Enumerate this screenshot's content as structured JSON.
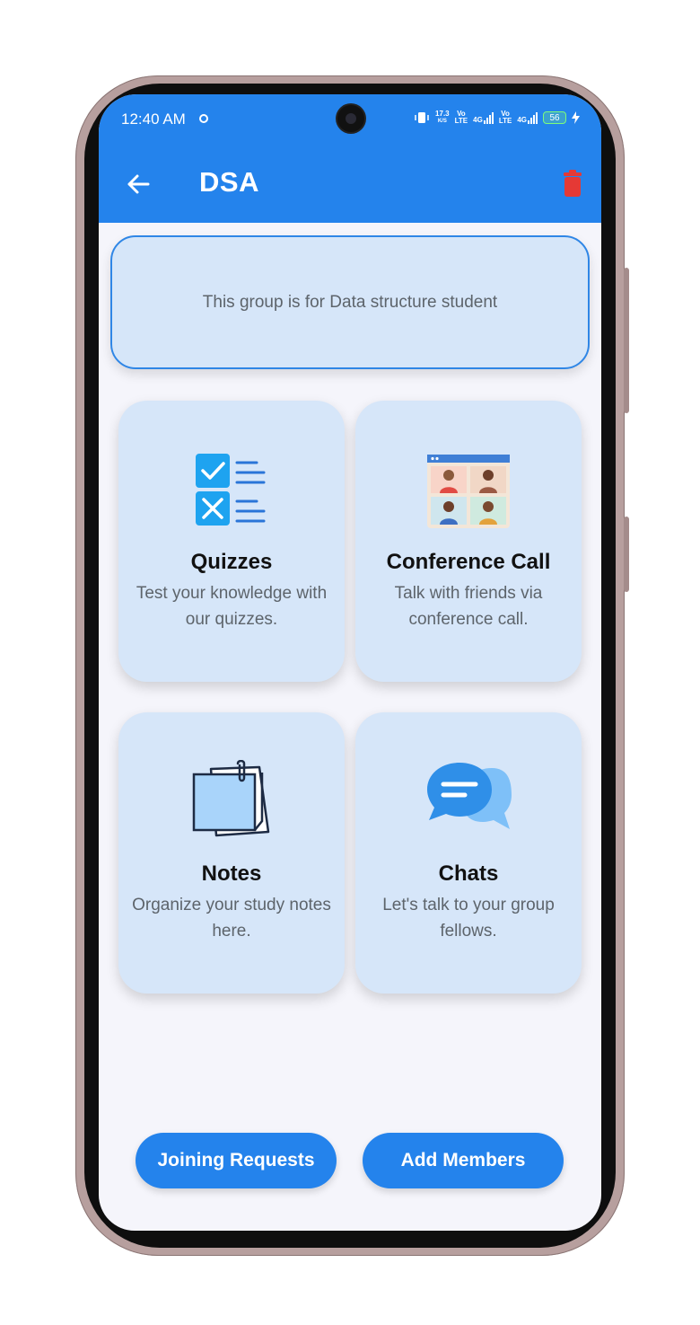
{
  "status_bar": {
    "time": "12:40 AM",
    "net_speed_value": "17.3",
    "net_speed_unit": "K/S",
    "volte_1_top": "Vo",
    "volte_1_bottom": "LTE",
    "net_type_1": "4G",
    "volte_2_top": "Vo",
    "volte_2_bottom": "LTE",
    "net_type_2": "4G",
    "battery_level": "56"
  },
  "app_bar": {
    "title": "DSA",
    "background_color": "#2483ec",
    "delete_icon_color": "#e53935"
  },
  "group_description": "This group is for Data structure student",
  "cards": [
    {
      "title": "Quizzes",
      "description": "Test your knowledge with our quizzes.",
      "icon": "quiz-checklist-icon"
    },
    {
      "title": "Conference Call",
      "description": "Talk with friends via conference call.",
      "icon": "video-conference-icon"
    },
    {
      "title": "Notes",
      "description": "Organize your study notes here.",
      "icon": "notes-paper-icon"
    },
    {
      "title": "Chats",
      "description": "Let's talk to your group fellows.",
      "icon": "chat-bubbles-icon"
    }
  ],
  "buttons": {
    "joining_requests": "Joining Requests",
    "add_members": "Add Members"
  }
}
